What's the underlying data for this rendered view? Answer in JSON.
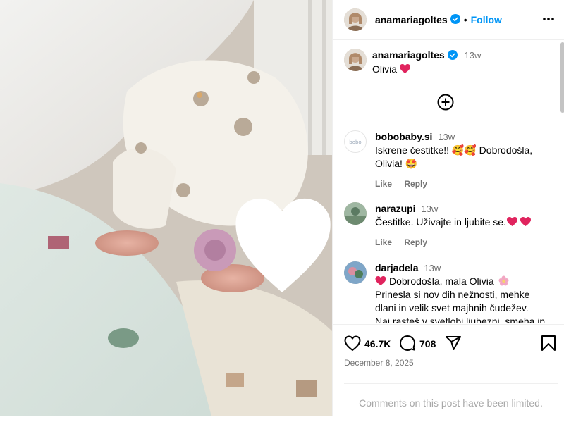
{
  "post": {
    "username": "anamariagoltes",
    "follow_label": "Follow",
    "caption_time": "13w",
    "caption_text": "Olivia"
  },
  "comments": [
    {
      "username": "bobobaby.si",
      "time": "13w",
      "text_line1": "Iskrene čestitke!! 🥰🥰 Dobrodošla,",
      "text_line2": "Olivia! 🤩",
      "like": "Like",
      "reply": "Reply"
    },
    {
      "username": "narazupi",
      "time": "13w",
      "text_line1": "Čestitke. Uživajte in ljubite se.",
      "like": "Like",
      "reply": "Reply"
    },
    {
      "username": "darjadela",
      "time": "13w",
      "text_line1": "Dobrodošla, mala Olivia",
      "text_line2": "Prinesla si nov dih nežnosti, mehke",
      "text_line3": "dlani in velik svet majhnih čudežev.",
      "text_line4": "Naj rasteš v svetlobi ljubezni, smeha in"
    }
  ],
  "stats": {
    "likes": "46.7K",
    "comments": "708",
    "date": "December 8, 2025"
  },
  "footer": {
    "limited_text": "Comments on this post have been limited."
  },
  "colors": {
    "accent": "#0095f6",
    "heart": "#e0245e",
    "muted": "#737373"
  }
}
